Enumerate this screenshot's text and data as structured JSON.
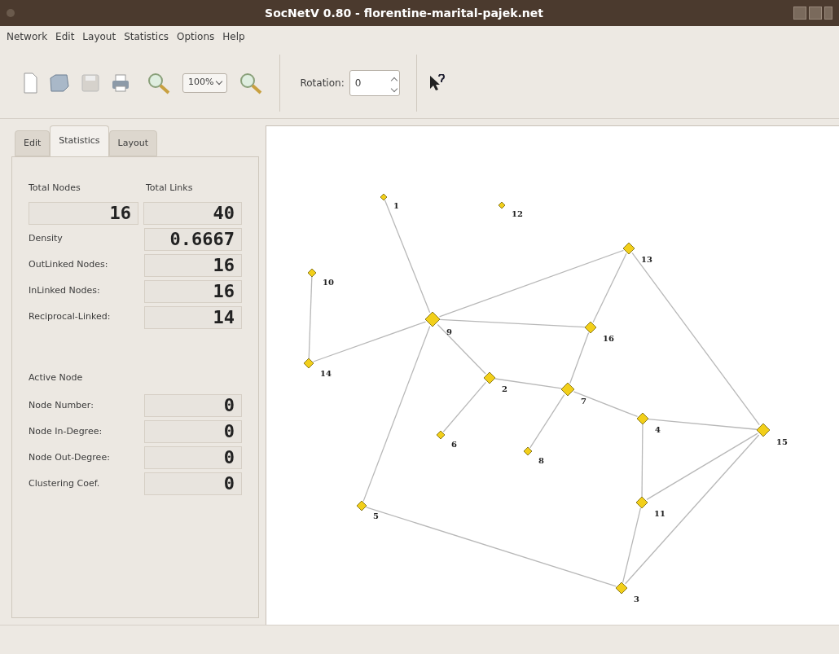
{
  "window": {
    "title": "SocNetV 0.80 - florentine-marital-pajek.net"
  },
  "menu": [
    "Network",
    "Edit",
    "Layout",
    "Statistics",
    "Options",
    "Help"
  ],
  "toolbar": {
    "zoom": "100%",
    "rotation_label": "Rotation:",
    "rotation": "0"
  },
  "tabs": [
    {
      "label": "Edit",
      "selected": false
    },
    {
      "label": "Statistics",
      "selected": true
    },
    {
      "label": "Layout",
      "selected": false
    }
  ],
  "totals": {
    "nodes_label": "Total Nodes",
    "links_label": "Total Links",
    "nodes": "16",
    "links": "40"
  },
  "stats": [
    {
      "label": "Density",
      "value": "0.6667"
    },
    {
      "label": "OutLinked Nodes:",
      "value": "16"
    },
    {
      "label": "InLinked Nodes:",
      "value": "16"
    },
    {
      "label": "Reciprocal-Linked:",
      "value": "14"
    }
  ],
  "active_node": {
    "heading": "Active Node",
    "rows": [
      {
        "label": "Node Number:",
        "value": "0"
      },
      {
        "label": "Node In-Degree:",
        "value": "0"
      },
      {
        "label": "Node Out-Degree:",
        "value": "0"
      },
      {
        "label": "Clustering Coef.",
        "value": "0"
      }
    ]
  },
  "graph": {
    "nodes": [
      "1",
      "12",
      "10",
      "14",
      "9",
      "2",
      "16",
      "13",
      "7",
      "4",
      "6",
      "8",
      "15",
      "11",
      "5",
      "3"
    ]
  }
}
